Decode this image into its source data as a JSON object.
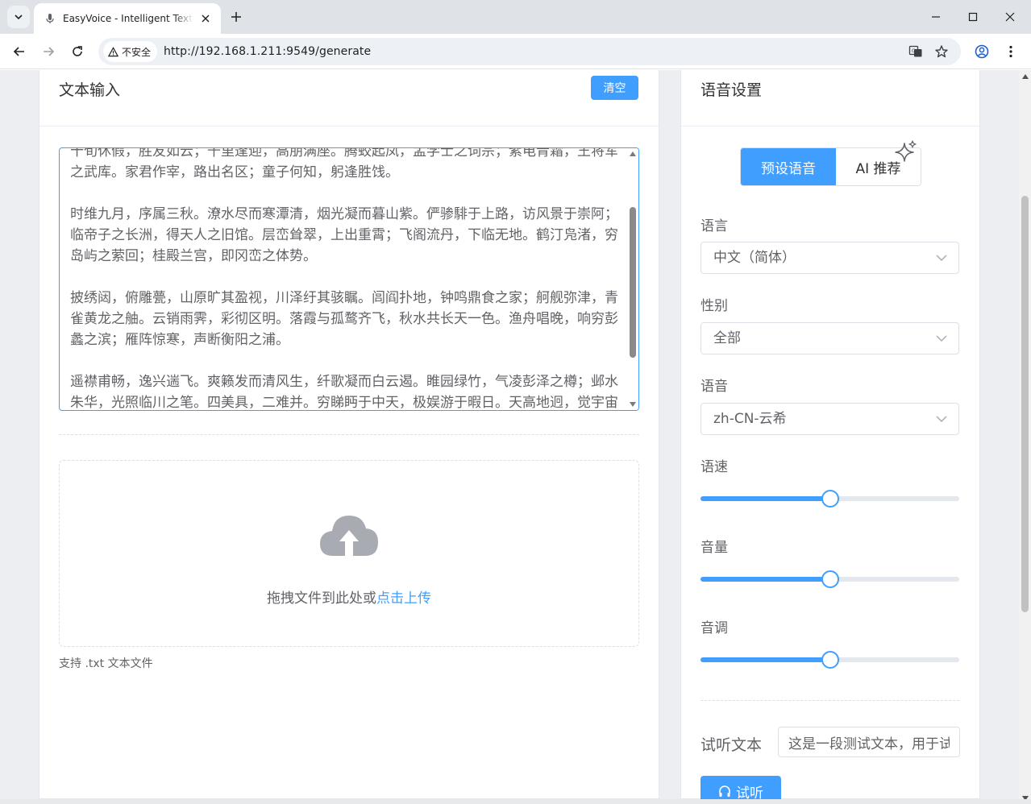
{
  "browser": {
    "tab_title": "EasyVoice - Intelligent Text-to-Speech",
    "security_label": "不安全",
    "url": "http://192.168.1.211:9549/generate"
  },
  "text_input": {
    "title": "文本输入",
    "clear_label": "清空",
    "paragraphs": [
      "十旬休假，胜友如云；千里逢迎，高朋满座。腾蛟起凤，孟学士之词宗；紫电青霜，王将军之武库。家君作宰，路出名区；童子何知，躬逢胜饯。",
      "",
      "时维九月，序属三秋。潦水尽而寒潭清，烟光凝而暮山紫。俨骖騑于上路，访风景于崇阿；临帝子之长洲，得天人之旧馆。层峦耸翠，上出重霄；飞阁流丹，下临无地。鹤汀凫渚，穷岛屿之萦回；桂殿兰宫，即冈峦之体势。",
      "",
      "披绣闼，俯雕甍，山原旷其盈视，川泽纡其骇瞩。闾阎扑地，钟鸣鼎食之家；舸舰弥津，青雀黄龙之舳。云销雨霁，彩彻区明。落霞与孤鹜齐飞，秋水共长天一色。渔舟唱晚，响穷彭蠡之滨；雁阵惊寒，声断衡阳之浦。",
      "",
      "遥襟甫畅，逸兴遄飞。爽籁发而清风生，纤歌凝而白云遏。睢园绿竹，气凌彭泽之樽；邺水朱华，光照临川之笔。四美具，二难并。穷睇眄于中天，极娱游于暇日。天高地迥，觉宇宙之无穷；兴尽悲来，识盈虚之有数。"
    ],
    "upload_text": "拖拽文件到此处或",
    "upload_link": "点击上传",
    "upload_tip": "支持 .txt 文本文件"
  },
  "voice_settings": {
    "title": "语音设置",
    "segments": {
      "preset": "预设语音",
      "ai": "AI 推荐"
    },
    "language": {
      "label": "语言",
      "value": "中文（简体）"
    },
    "gender": {
      "label": "性别",
      "value": "全部"
    },
    "voice": {
      "label": "语音",
      "value": "zh-CN-云希"
    },
    "rate": {
      "label": "语速",
      "fraction": 0.5
    },
    "volume": {
      "label": "音量",
      "fraction": 0.5
    },
    "pitch": {
      "label": "音调",
      "fraction": 0.5
    },
    "preview_label": "试听文本",
    "preview_value": "这是一段测试文本，用于试听声音效果",
    "listen_label": "试听"
  },
  "colors": {
    "accent": "#409eff",
    "page_bg": "#eceef1"
  }
}
